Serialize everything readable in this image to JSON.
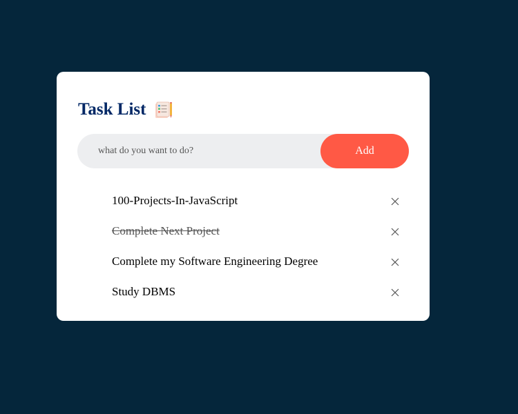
{
  "colors": {
    "background": "#05263b",
    "card": "#ffffff",
    "accent": "#ff5945",
    "title": "#002765",
    "input_background": "#edeef0"
  },
  "app": {
    "title": "Task List",
    "title_icon": "notepad-checklist-icon"
  },
  "input": {
    "placeholder": "what do you want to do?",
    "value": ""
  },
  "add_button": {
    "label": "Add"
  },
  "tasks": [
    {
      "text": "100-Projects-In-JavaScript",
      "completed": false,
      "remove_icon": "close-icon"
    },
    {
      "text": "Complete Next Project",
      "completed": true,
      "remove_icon": "close-icon"
    },
    {
      "text": "Complete my Software Engineering Degree",
      "completed": false,
      "remove_icon": "close-icon"
    },
    {
      "text": "Study DBMS",
      "completed": false,
      "remove_icon": "close-icon"
    }
  ]
}
